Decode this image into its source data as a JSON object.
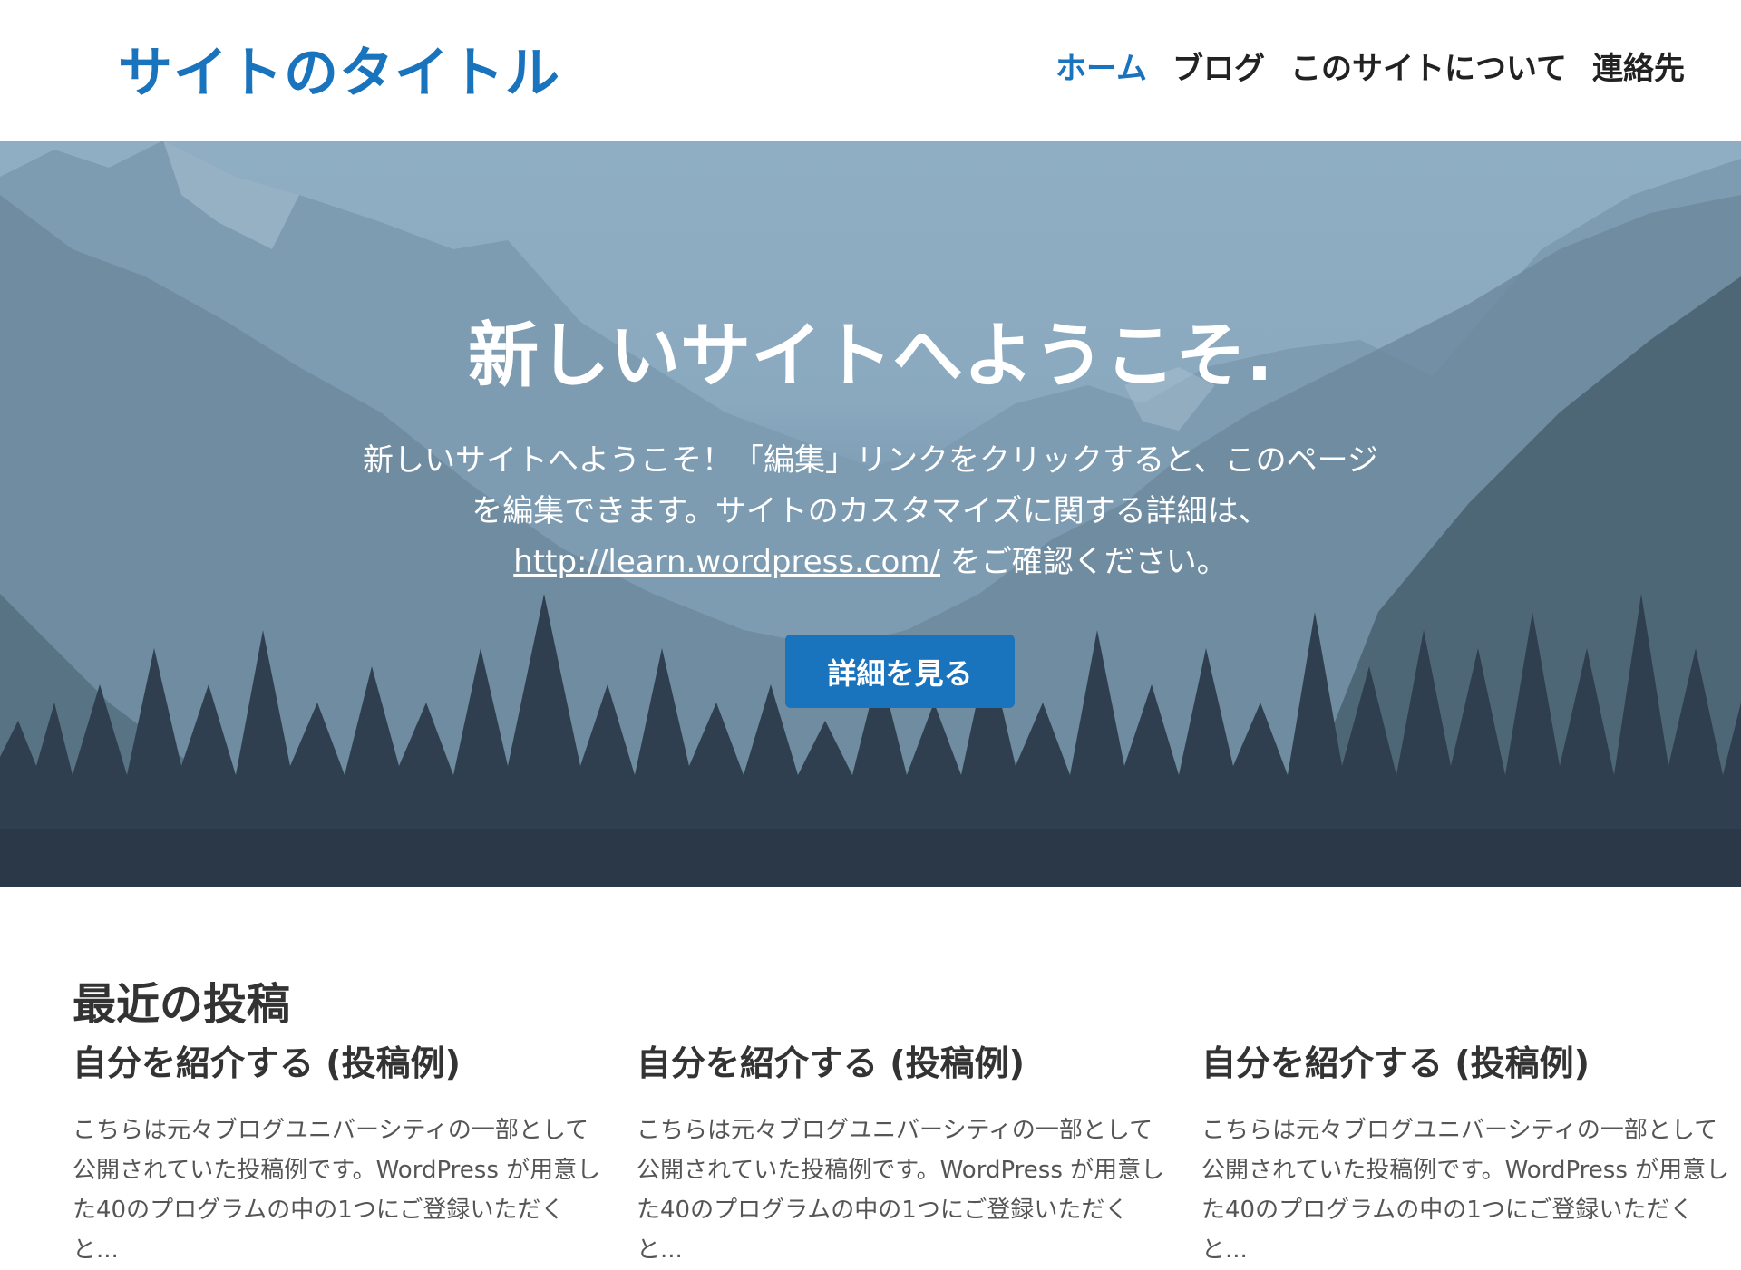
{
  "header": {
    "site_title": "サイトのタイトル",
    "nav": [
      {
        "label": "ホーム",
        "active": true
      },
      {
        "label": "ブログ",
        "active": false
      },
      {
        "label": "このサイトについて",
        "active": false
      },
      {
        "label": "連絡先",
        "active": false
      }
    ]
  },
  "hero": {
    "title": "新しいサイトへようこそ.",
    "text_before": "新しいサイトへようこそ！「編集」リンクをクリックすると、このページを編集できます。サイトのカスタマイズに関する詳細は、",
    "link_text": "http://learn.wordpress.com/",
    "text_after": " をご確認ください。",
    "button_label": "詳細を見る"
  },
  "recent": {
    "heading": "最近の投稿",
    "posts": [
      {
        "title": "自分を紹介する (投稿例)",
        "excerpt": "こちらは元々ブログユニバーシティの一部として公開されていた投稿例です。WordPress が用意した40のプログラムの中の1つにご登録いただくと..."
      },
      {
        "title": "自分を紹介する (投稿例)",
        "excerpt": "こちらは元々ブログユニバーシティの一部として公開されていた投稿例です。WordPress が用意した40のプログラムの中の1つにご登録いただくと..."
      },
      {
        "title": "自分を紹介する (投稿例)",
        "excerpt": "こちらは元々ブログユニバーシティの一部として公開されていた投稿例です。WordPress が用意した40のプログラムの中の1つにご登録いただくと..."
      }
    ]
  },
  "colors": {
    "accent": "#1a73bd",
    "text": "#333333",
    "hero_sky": "#8faec4"
  }
}
